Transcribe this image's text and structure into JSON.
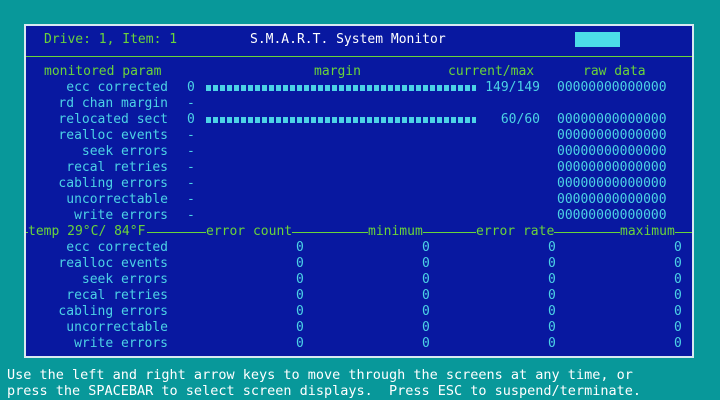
{
  "header": {
    "drive_item": "Drive: 1, Item: 1",
    "title": "S.M.A.R.T. System Monitor"
  },
  "top_table": {
    "columns": [
      "monitored param",
      "margin",
      "current/max",
      "raw data"
    ],
    "rows": [
      {
        "param": "ecc corrected",
        "margin": "0",
        "current_max": "149/149",
        "raw": "00000000000000",
        "bar_fraction": 1.0
      },
      {
        "param": "rd chan margin",
        "margin": "-",
        "current_max": "",
        "raw": "",
        "bar_fraction": 0
      },
      {
        "param": "relocated sect",
        "margin": "0",
        "current_max": "60/60",
        "raw": "00000000000000",
        "bar_fraction": 1.0
      },
      {
        "param": "realloc events",
        "margin": "-",
        "current_max": "",
        "raw": "00000000000000",
        "bar_fraction": 0
      },
      {
        "param": "seek errors",
        "margin": "-",
        "current_max": "",
        "raw": "00000000000000",
        "bar_fraction": 0
      },
      {
        "param": "recal retries",
        "margin": "-",
        "current_max": "",
        "raw": "00000000000000",
        "bar_fraction": 0
      },
      {
        "param": "cabling errors",
        "margin": "-",
        "current_max": "",
        "raw": "00000000000000",
        "bar_fraction": 0
      },
      {
        "param": "uncorrectable",
        "margin": "-",
        "current_max": "",
        "raw": "00000000000000",
        "bar_fraction": 0
      },
      {
        "param": "write errors",
        "margin": "-",
        "current_max": "",
        "raw": "00000000000000",
        "bar_fraction": 0
      }
    ]
  },
  "divider": {
    "temp": "temp 29°C/ 84°F",
    "columns": [
      "error count",
      "minimum",
      "error rate",
      "maximum"
    ]
  },
  "bottom_table": {
    "rows": [
      {
        "param": "ecc corrected",
        "error_count": "0",
        "minimum": "0",
        "error_rate": "0",
        "maximum": "0"
      },
      {
        "param": "realloc events",
        "error_count": "0",
        "minimum": "0",
        "error_rate": "0",
        "maximum": "0"
      },
      {
        "param": "seek errors",
        "error_count": "0",
        "minimum": "0",
        "error_rate": "0",
        "maximum": "0"
      },
      {
        "param": "recal retries",
        "error_count": "0",
        "minimum": "0",
        "error_rate": "0",
        "maximum": "0"
      },
      {
        "param": "cabling errors",
        "error_count": "0",
        "minimum": "0",
        "error_rate": "0",
        "maximum": "0"
      },
      {
        "param": "uncorrectable",
        "error_count": "0",
        "minimum": "0",
        "error_rate": "0",
        "maximum": "0"
      },
      {
        "param": "write errors",
        "error_count": "0",
        "minimum": "0",
        "error_rate": "0",
        "maximum": "0"
      }
    ]
  },
  "footer": {
    "line1": "Use the left and right arrow keys to move through the screens at any time, or",
    "line2": "press the SPACEBAR to select screen displays.  Press ESC to suspend/terminate."
  },
  "colors": {
    "background": "#08989a",
    "panel": "#0818a0",
    "label": "#4cd2e6",
    "header": "#6ad43a",
    "indicator": "#4cdde8"
  }
}
